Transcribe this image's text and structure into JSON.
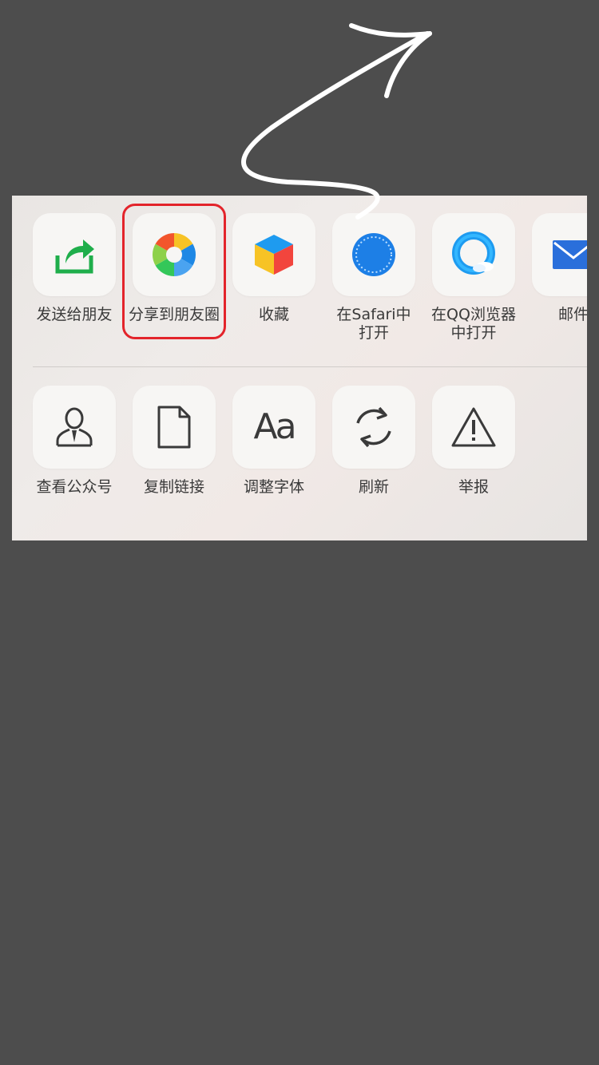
{
  "share_sheet": {
    "row1": [
      {
        "label": "发送给朋友",
        "icon": "forward-arrow-icon"
      },
      {
        "label": "分享到朋友圈",
        "icon": "aperture-moments-icon"
      },
      {
        "label": "收藏",
        "icon": "cube-favorites-icon"
      },
      {
        "label": "在Safari中\n打开",
        "icon": "safari-compass-icon"
      },
      {
        "label": "在QQ浏览器\n中打开",
        "icon": "qq-browser-icon"
      },
      {
        "label": "邮件",
        "icon": "mail-envelope-icon"
      }
    ],
    "row2": [
      {
        "label": "查看公众号",
        "icon": "official-account-person-icon"
      },
      {
        "label": "复制链接",
        "icon": "document-copy-icon"
      },
      {
        "label": "调整字体",
        "icon": "font-aa-icon"
      },
      {
        "label": "刷新",
        "icon": "refresh-icon"
      },
      {
        "label": "举报",
        "icon": "warning-triangle-icon"
      }
    ],
    "row2_icon_text": {
      "font": "Aa"
    },
    "highlighted_item": "分享到朋友圈",
    "colors": {
      "highlight": "#e3242b",
      "forward_green": "#1fae4b",
      "mail_blue": "#2a6fdb",
      "background": "#4d4d4d"
    }
  }
}
